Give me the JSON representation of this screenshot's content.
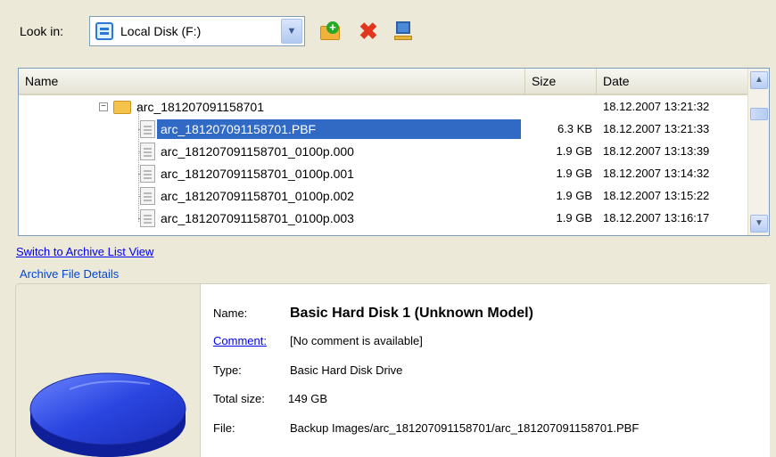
{
  "toolbar": {
    "lookin_label": "Look in:",
    "drive": "Local Disk (F:)",
    "icons": [
      "new-folder-icon",
      "delete-icon",
      "properties-icon"
    ]
  },
  "filelist": {
    "columns": {
      "name": "Name",
      "size": "Size",
      "date": "Date"
    },
    "folder": {
      "name": "arc_181207091158701",
      "date": "18.12.2007 13:21:32"
    },
    "files": [
      {
        "name": "arc_181207091158701.PBF",
        "size": "6.3 KB",
        "date": "18.12.2007 13:21:33",
        "selected": true
      },
      {
        "name": "arc_181207091158701_0100p.000",
        "size": "1.9 GB",
        "date": "18.12.2007 13:13:39"
      },
      {
        "name": "arc_181207091158701_0100p.001",
        "size": "1.9 GB",
        "date": "18.12.2007 13:14:32"
      },
      {
        "name": "arc_181207091158701_0100p.002",
        "size": "1.9 GB",
        "date": "18.12.2007 13:15:22"
      },
      {
        "name": "arc_181207091158701_0100p.003",
        "size": "1.9 GB",
        "date": "18.12.2007 13:16:17"
      }
    ]
  },
  "switch_link": "Switch to Archive List View",
  "details": {
    "legend": "Archive File Details",
    "name_label": "Name:",
    "name_value": "Basic Hard Disk 1 (Unknown Model)",
    "comment_label": "Comment:",
    "comment_value": "[No comment is available]",
    "type_label": "Type:",
    "type_value": "Basic Hard Disk Drive",
    "size_label": "Total size:",
    "size_value": "149 GB",
    "file_label": "File:",
    "file_value": "Backup Images/arc_181207091158701/arc_181207091158701.PBF"
  },
  "colors": {
    "selection": "#316ac5",
    "link": "#0000ee",
    "legend": "#0046d5",
    "disk": "#1f3ad6"
  }
}
